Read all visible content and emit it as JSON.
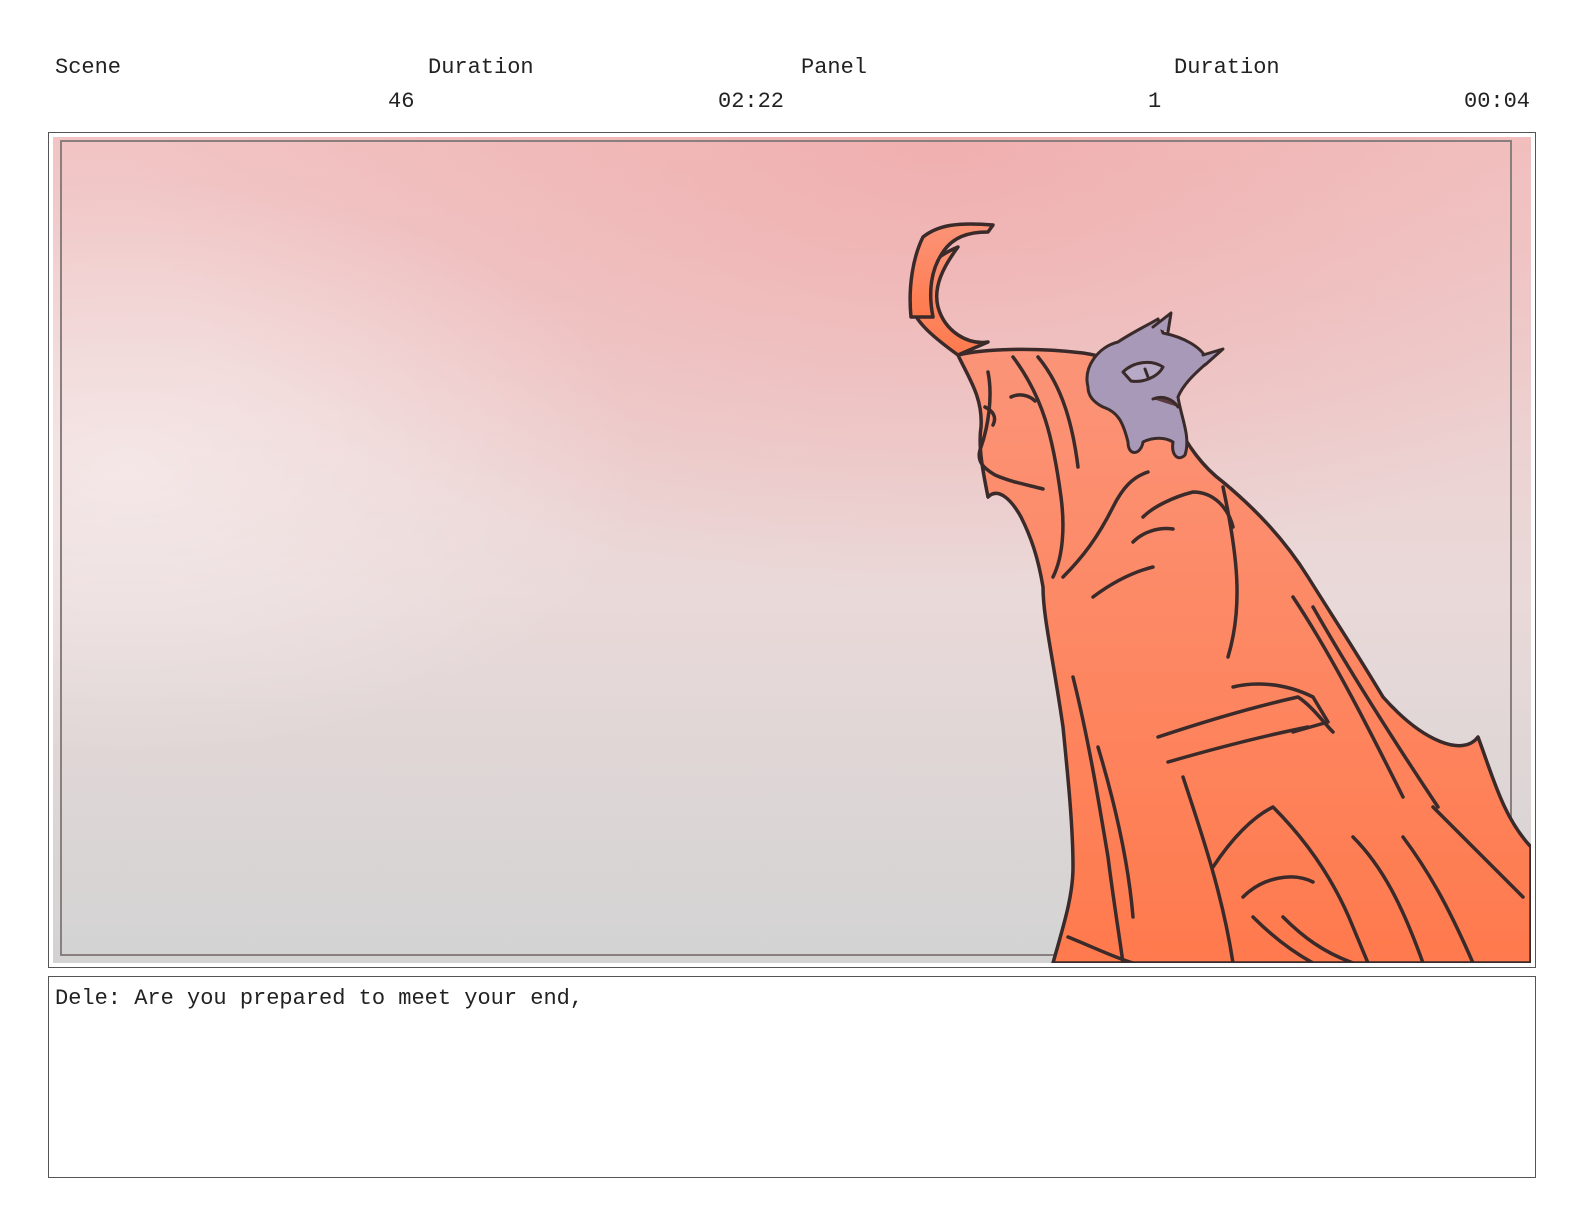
{
  "header": {
    "scene_label": "Scene",
    "scene_duration_label": "Duration",
    "panel_label": "Panel",
    "panel_duration_label": "Duration",
    "scene_number": "46",
    "scene_duration": "02:22",
    "panel_number": "1",
    "panel_duration": "00:04"
  },
  "panel": {
    "background_top": "#f2c4c4",
    "background_bottom": "#d3d3d3",
    "character_fill": "#fa8e6e",
    "companion_fill": "#a899b8"
  },
  "dialogue": {
    "text": "Dele: Are you prepared to meet your end,"
  }
}
